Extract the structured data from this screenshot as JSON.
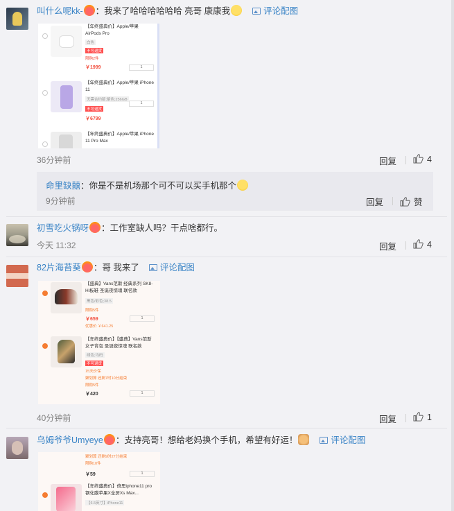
{
  "comments": [
    {
      "username": "叫什么呢kk-",
      "text": "：我来了哈哈哈哈哈哈 亮哥 康康我",
      "pic_link": "评论配图",
      "time": "36分钟前",
      "reply_label": "回复",
      "likes": "4",
      "screenshot": [
        {
          "title": "【年终盛典价】Apple/苹果 AirPods Pro",
          "tag": "白色",
          "redtag": "不可退货",
          "note": "限购2件",
          "price": "￥1999",
          "qty": "1"
        },
        {
          "title": "【年终盛典价】Apple/苹果 iPhone 11",
          "tag": "无需合约版;紫色;256GB",
          "redtag": "不可退货",
          "note": "",
          "price": "￥6799",
          "qty": "1"
        },
        {
          "title": "【年终盛典价】Apple/苹果 iPhone 11 Pro Max",
          "tag": "",
          "redtag": "",
          "note": "",
          "price": "",
          "qty": ""
        }
      ],
      "sub_reply": {
        "username": "命里缺囍",
        "text": "：你是不是机场那个可不可以买手机那个",
        "time": "9分钟前",
        "reply_label": "回复",
        "like_label": "赞"
      }
    },
    {
      "username": "初雪吃火锅呀",
      "text": "：工作室缺人吗？干点啥都行。",
      "time": "今天 11:32",
      "reply_label": "回复",
      "likes": "4"
    },
    {
      "username": "82片海苔葵",
      "text": "：哥 我来了",
      "pic_link": "评论配图",
      "time": "40分钟前",
      "reply_label": "回复",
      "likes": "1",
      "screenshot": [
        {
          "title": "【盛典】Vans范斯 经典系列 SK8-Hi板鞋 圣诞夜惊魂 联名款",
          "tag": "黑色/彩色;38.5",
          "note": "限购5件",
          "price": "￥659",
          "extra": "优惠价 ￥641.25",
          "qty": "1"
        },
        {
          "title": "【年终盛典价】【盛典】Vans范斯 女子背包 圣诞夜惊魂 联名款",
          "tag": "绿色;均码",
          "redtag": "不可退货",
          "note": "15天价保",
          "extra": "聚划算 还剩7时10分结束",
          "note2": "限购5件",
          "price": "￥420",
          "qty": "1"
        }
      ]
    },
    {
      "username": "乌姆爷爷Umyeye",
      "text": "：支持亮哥！想给老妈换个手机，希望有好运！",
      "pic_link": "评论配图",
      "screenshot": [
        {
          "note": "聚划算 还剩9时27分结束",
          "note2": "限购10件",
          "price": "￥59",
          "qty": "1"
        },
        {
          "title": "【年终盛典价】倍思iphone11 pro钢化膜苹果X全屏Xs Max...",
          "tag": "【6.5英寸】iPhone11",
          "qty": ""
        }
      ]
    }
  ],
  "colors": {
    "link": "#3a84c6",
    "bg": "#f2f2f5",
    "reply_bg": "#e9e9ee",
    "price": "#f24e3e"
  }
}
